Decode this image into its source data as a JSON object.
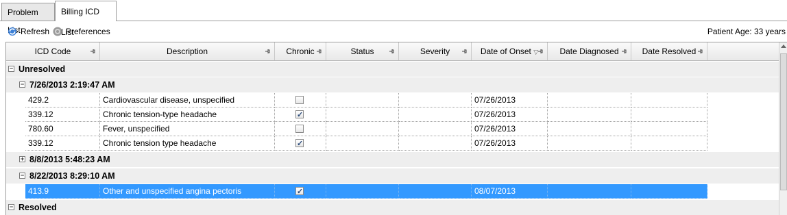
{
  "tabs": [
    "Problem List",
    "Billing ICD List"
  ],
  "toolbar": {
    "refresh": "Refresh",
    "preferences": "Preferences",
    "patient_age": "Patient Age: 33 years"
  },
  "columns": [
    "ICD Code",
    "Description",
    "Chronic",
    "Status",
    "Severity",
    "Date of Onset",
    "Date Diagnosed",
    "Date Resolved"
  ],
  "groups": {
    "unresolved": "Unresolved",
    "g1": "7/26/2013 2:19:47 AM",
    "g2": "8/8/2013 5:48:23 AM",
    "g3": "8/22/2013 8:29:10 AM",
    "resolved": "Resolved"
  },
  "rows": [
    {
      "icd": "429.2",
      "desc": "Cardiovascular disease, unspecified",
      "chronic": false,
      "status": "",
      "severity": "",
      "onset": "07/26/2013",
      "diagnosed": "",
      "resolved": ""
    },
    {
      "icd": "339.12",
      "desc": "Chronic tension-type headache",
      "chronic": true,
      "status": "",
      "severity": "",
      "onset": "07/26/2013",
      "diagnosed": "",
      "resolved": ""
    },
    {
      "icd": "780.60",
      "desc": "Fever, unspecified",
      "chronic": false,
      "status": "",
      "severity": "",
      "onset": "07/26/2013",
      "diagnosed": "",
      "resolved": ""
    },
    {
      "icd": "339.12",
      "desc": "Chronic tension type headache",
      "chronic": true,
      "status": "",
      "severity": "",
      "onset": "07/26/2013",
      "diagnosed": "",
      "resolved": ""
    },
    {
      "icd": "413.9",
      "desc": "Other and unspecified angina pectoris",
      "chronic": true,
      "status": "",
      "severity": "",
      "onset": "08/07/2013",
      "diagnosed": "",
      "resolved": ""
    }
  ],
  "colors": {
    "selection": "#3399ff",
    "group_bg": "#eeeeee"
  }
}
